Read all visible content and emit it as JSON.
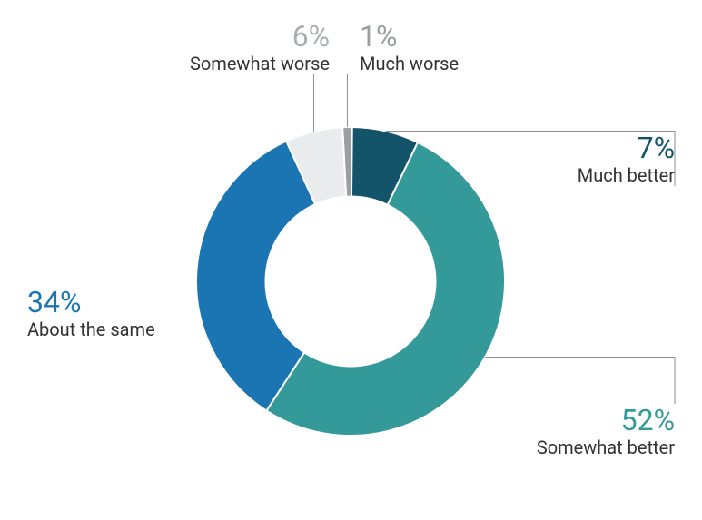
{
  "chart_data": {
    "type": "pie",
    "title": "",
    "series": [
      {
        "name": "Much worse",
        "value": 1,
        "label_pct": "1%",
        "color": "#9aa0a2"
      },
      {
        "name": "Much better",
        "value": 7,
        "label_pct": "7%",
        "color": "#13546b"
      },
      {
        "name": "Somewhat better",
        "value": 52,
        "label_pct": "52%",
        "color": "#339999"
      },
      {
        "name": "About the same",
        "value": 34,
        "label_pct": "34%",
        "color": "#1b75b3"
      },
      {
        "name": "Somewhat worse",
        "value": 6,
        "label_pct": "6%",
        "color": "#e9ebec"
      }
    ],
    "donut_inner_ratio": 0.55,
    "start_angle_deg": -3
  },
  "labels": {
    "much_worse": {
      "pct": "1%",
      "txt": "Much worse"
    },
    "much_better": {
      "pct": "7%",
      "txt": "Much better"
    },
    "somewhat_better": {
      "pct": "52%",
      "txt": "Somewhat better"
    },
    "about_the_same": {
      "pct": "34%",
      "txt": "About the same"
    },
    "somewhat_worse": {
      "pct": "6%",
      "txt": "Somewhat worse"
    }
  },
  "colors": {
    "leader": "#8a8f91",
    "much_worse_pct": "#9aa0a2",
    "much_better_pct": "#13546b",
    "somewhat_better_pct": "#339999",
    "about_the_same_pct": "#1b75b3",
    "somewhat_worse_pct": "#a9adaf"
  }
}
